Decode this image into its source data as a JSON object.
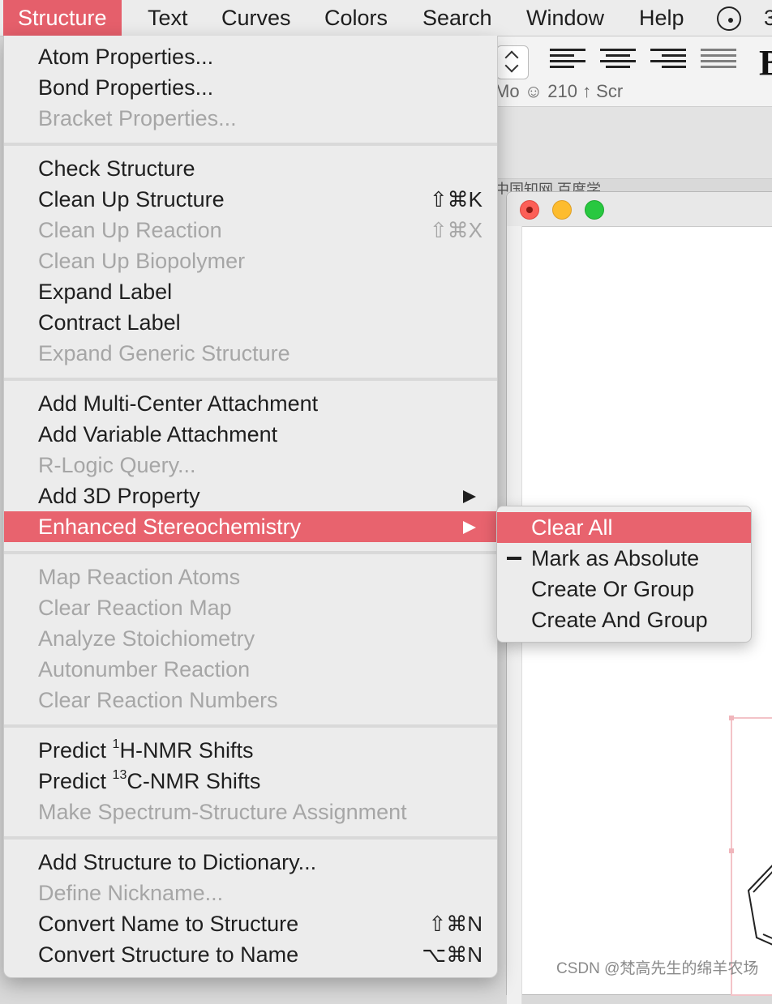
{
  "menubar": {
    "items": [
      "Structure",
      "Text",
      "Curves",
      "Colors",
      "Search",
      "Window",
      "Help"
    ],
    "status_icon": "record-circle-icon",
    "truncated": "3"
  },
  "background": {
    "toolbar_strip": "Mo   ☺  210   ↑  Scr",
    "bookmarks": "中国知网    百度学",
    "watermark": "CSDN @梵高先生的绵羊农场"
  },
  "structure_menu": {
    "atom_properties": "Atom Properties...",
    "bond_properties": "Bond Properties...",
    "bracket_properties": "Bracket Properties...",
    "check_structure": "Check Structure",
    "clean_up_structure": "Clean Up Structure",
    "clean_up_structure_sc": "⇧⌘K",
    "clean_up_reaction": "Clean Up Reaction",
    "clean_up_reaction_sc": "⇧⌘X",
    "clean_up_biopolymer": "Clean Up Biopolymer",
    "expand_label": "Expand Label",
    "contract_label": "Contract Label",
    "expand_generic": "Expand Generic Structure",
    "add_multi_center": "Add Multi-Center Attachment",
    "add_variable": "Add Variable Attachment",
    "r_logic": "R-Logic Query...",
    "add_3d": "Add 3D Property",
    "enhanced_stereo": "Enhanced Stereochemistry",
    "map_reaction": "Map Reaction Atoms",
    "clear_reaction_map": "Clear Reaction Map",
    "analyze_stoich": "Analyze Stoichiometry",
    "autonumber": "Autonumber Reaction",
    "clear_reaction_numbers": "Clear Reaction Numbers",
    "predict": "Predict ",
    "h_sup": "1",
    "h_rest": "H-NMR Shifts",
    "c_sup": "13",
    "c_rest": "C-NMR Shifts",
    "make_spectrum": "Make Spectrum-Structure Assignment",
    "add_dictionary": "Add Structure to Dictionary...",
    "define_nickname": "Define Nickname...",
    "convert_name": "Convert Name to Structure",
    "convert_name_sc": "⇧⌘N",
    "convert_structure": "Convert Structure to Name",
    "convert_structure_sc": "⌥⌘N"
  },
  "submenu": {
    "clear_all": "Clear All",
    "mark_absolute": "Mark as Absolute",
    "create_or": "Create Or Group",
    "create_and": "Create And Group"
  }
}
